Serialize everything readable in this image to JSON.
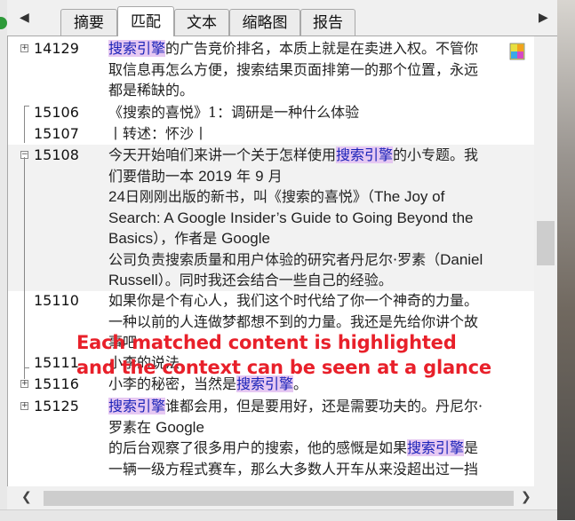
{
  "tabs": [
    {
      "label": "摘要"
    },
    {
      "label": "匹配"
    },
    {
      "label": "文本"
    },
    {
      "label": "缩略图"
    },
    {
      "label": "报告"
    }
  ],
  "active_tab": "匹配",
  "highlight_term": "搜索引擎",
  "rows": [
    {
      "id": "14129",
      "lines": [
        [
          {
            "t": "搜索引擎",
            "h": true
          },
          {
            "t": "的广告竞价排名，本质上就是在卖进入权。不管你"
          }
        ],
        [
          {
            "t": "取信息再怎么方便，搜索结果页面排第一的那个位置，永远"
          }
        ],
        [
          {
            "t": "都是稀缺的。"
          }
        ]
      ]
    },
    {
      "id": "15106",
      "lines": [
        [
          {
            "t": "《搜索的喜悦》1：调研是一种什么体验"
          }
        ]
      ]
    },
    {
      "id": "15107",
      "lines": [
        [
          {
            "t": "丨转述：怀沙丨"
          }
        ]
      ]
    },
    {
      "id": "15108",
      "lines": [
        [
          {
            "t": "今天开始咱们来讲一个关于怎样使用"
          },
          {
            "t": "搜索引擎",
            "h": true
          },
          {
            "t": "的小专题。我"
          }
        ],
        [
          {
            "t": "们要借助一本 "
          },
          {
            "t": "2019",
            "l": true
          },
          {
            "t": " 年 "
          },
          {
            "t": "9",
            "l": true
          },
          {
            "t": " 月"
          }
        ],
        [
          {
            "t": "24",
            "l": true
          },
          {
            "t": "日刚刚出版的新书，叫《搜索的喜悦》（"
          },
          {
            "t": "The Joy of",
            "l": true
          }
        ],
        [
          {
            "t": "Search: A Google Insider’s Guide to Going Beyond the",
            "l": true
          }
        ],
        [
          {
            "t": "Basics",
            "l": true
          },
          {
            "t": "），作者是 "
          },
          {
            "t": "Google",
            "l": true
          }
        ],
        [
          {
            "t": "公司负责搜索质量和用户体验的研究者丹尼尔·罗素（"
          },
          {
            "t": "Daniel",
            "l": true
          }
        ],
        [
          {
            "t": "Russell",
            "l": true
          },
          {
            "t": "）。同时我还会结合一些自己的经验。"
          }
        ]
      ]
    },
    {
      "id": "15110",
      "lines": [
        [
          {
            "t": "如果你是个有心人，我们这个时代给了你一个神奇的力量。"
          }
        ],
        [
          {
            "t": "一种以前的人连做梦都想不到的力量。我还是先给你讲个故"
          }
        ],
        [
          {
            "t": "事吧"
          }
        ]
      ]
    },
    {
      "id": "15111",
      "lines": [
        [
          {
            "t": "小李的说法"
          }
        ]
      ]
    },
    {
      "id": "15116",
      "lines": [
        [
          {
            "t": "小李的秘密，当然是"
          },
          {
            "t": "搜索引擎",
            "h": true
          },
          {
            "t": "。"
          }
        ]
      ]
    },
    {
      "id": "15125",
      "lines": [
        [
          {
            "t": "搜索引擎",
            "h": true
          },
          {
            "t": "谁都会用，但是要用好，还是需要功夫的。丹尼尔·"
          }
        ],
        [
          {
            "t": "罗素在 "
          },
          {
            "t": "Google",
            "l": true
          }
        ],
        [
          {
            "t": "的后台观察了很多用户的搜索，他的感慨是如果"
          },
          {
            "t": "搜索引擎",
            "h": true
          },
          {
            "t": "是"
          }
        ],
        [
          {
            "t": "一辆一级方程式赛车，那么大多数人开车从来没超出过一挡"
          }
        ]
      ]
    }
  ],
  "annotation": {
    "line1": "Each matched content is highlighted",
    "line2": "and the context can be seen at a glance"
  },
  "icons": {
    "tab_prev": "chevron-left-icon",
    "tab_next": "chevron-right-icon",
    "scroll_left": "chevron-left-icon",
    "scroll_right": "chevron-right-icon",
    "corner": "color-palette-icon"
  },
  "colors": {
    "highlight_bg": "#e6c8f2",
    "highlight_text": "#1a22b8",
    "annotation": "#e8202a"
  }
}
